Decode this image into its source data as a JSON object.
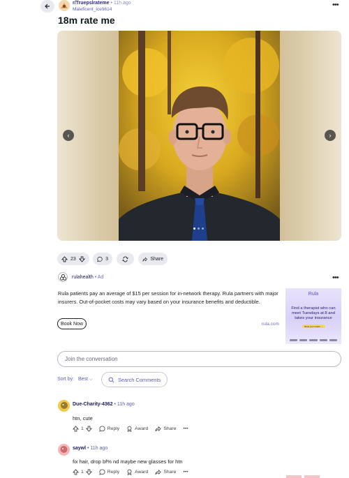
{
  "header": {
    "subreddit": "r/Truepslrateme",
    "separator": "•",
    "time": "11h ago",
    "username": "Maleficent_Ice9614",
    "more": "•••"
  },
  "post": {
    "title": "18m rate me",
    "image_alt_icons": {
      "prev": "chevron-left-icon",
      "next": "chevron-right-icon"
    },
    "carousel_pages": 3,
    "carousel_active": 1
  },
  "actions": {
    "votes": "23",
    "comments": "3",
    "share_label": "Share"
  },
  "ad": {
    "advertiser": "rulahealth",
    "separator": "•",
    "tag": "Ad",
    "more": "•••",
    "body": "Rula patients pay an average of $15 per session for in-network therapy. Rula partners with major insurers. Out-of-pocket costs may vary based on your insurance benefits and deductible.",
    "button_label": "Book Now",
    "domain": "rula.com",
    "image": {
      "brand": "Rula",
      "headline": "Find a therapist who can meet Tuesdays at 8 and takes your insurance",
      "cta": "Book your match →"
    }
  },
  "comment_box": {
    "placeholder": "Join the conversation"
  },
  "sort": {
    "label": "Sort by:",
    "value": "Best",
    "search_label": "Search Comments"
  },
  "comments": [
    {
      "author": "Due-Charity-4362",
      "time": "• 11h ago",
      "body": "htn, cute",
      "votes": "1",
      "reply": "Reply",
      "award": "Award",
      "share": "Share",
      "more": "•••"
    },
    {
      "author": "saywl",
      "time": "• 11h ago",
      "body": "fix hair, drop bf% nd maybe new glasses for htn",
      "votes": "1",
      "reply": "Reply",
      "award": "Award",
      "share": "Share",
      "more": "•••"
    }
  ],
  "colors": {
    "accent": "#5a5cc0",
    "pill_bg": "#e9eaf0",
    "ad_cta": "#f3d65f"
  }
}
